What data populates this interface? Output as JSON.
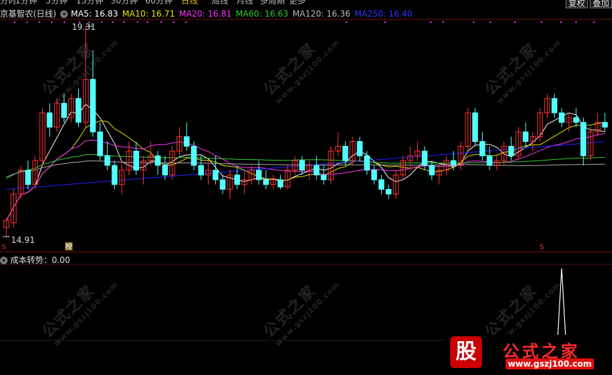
{
  "tabs": [
    "分时",
    "1分钟",
    "5分钟",
    "15分钟",
    "30分钟",
    "60分钟",
    "日线",
    "周线",
    "月线",
    "多周期",
    "更多"
  ],
  "active_tab": "日线",
  "buttons": {
    "b1": "复权",
    "b2": "叠加"
  },
  "legend": {
    "stock": "京基智农(日线)",
    "ma5": "MA5: 16.83",
    "ma10": "MA10: 16.71",
    "ma20": "MA20: 16.81",
    "ma60": "MA60: 16.63",
    "ma120": "MA120: 16.36",
    "ma250": "MA250: 16.40"
  },
  "labels": {
    "high": "19.31",
    "low": "14.91",
    "rank_badge": "榜",
    "s_badge_left": "S",
    "s_badge_right": "S"
  },
  "indicator": {
    "name": "成本转势：0.00"
  },
  "logo": {
    "gu": "股",
    "brand": "公式之家",
    "url": "www.gszj100.com"
  },
  "watermark": {
    "cn": "公式之家",
    "url": "www.gszj100.com"
  },
  "colors": {
    "up": "#ff3232",
    "down": "#54ffff",
    "ma5": "#ffffff",
    "ma10": "#e6e600",
    "ma20": "#ff33ff",
    "ma60": "#33cc33",
    "ma120": "#aaaaaa",
    "ma250": "#2222ff"
  },
  "chart_data": {
    "type": "candlestick",
    "price_range": [
      14.91,
      19.31
    ],
    "ohlc": [
      [
        15.1,
        15.3,
        14.91,
        15.25
      ],
      [
        15.2,
        15.9,
        15.1,
        15.8
      ],
      [
        15.8,
        16.4,
        15.7,
        16.3
      ],
      [
        16.3,
        16.5,
        15.9,
        16.0
      ],
      [
        16.0,
        16.6,
        15.9,
        16.5
      ],
      [
        16.5,
        17.6,
        16.4,
        17.5
      ],
      [
        17.5,
        17.7,
        17.0,
        17.2
      ],
      [
        17.2,
        17.8,
        17.1,
        17.7
      ],
      [
        17.7,
        17.9,
        17.3,
        17.4
      ],
      [
        17.4,
        17.9,
        17.3,
        17.8
      ],
      [
        17.8,
        18.0,
        17.2,
        17.3
      ],
      [
        17.3,
        19.31,
        17.2,
        18.2
      ],
      [
        18.2,
        18.8,
        17.0,
        17.1
      ],
      [
        17.1,
        17.3,
        16.5,
        16.6
      ],
      [
        16.6,
        16.9,
        16.3,
        16.4
      ],
      [
        16.4,
        16.5,
        15.9,
        16.0
      ],
      [
        16.0,
        16.5,
        15.8,
        16.3
      ],
      [
        16.3,
        16.9,
        16.2,
        16.7
      ],
      [
        16.7,
        16.9,
        16.2,
        16.3
      ],
      [
        16.3,
        16.6,
        16.0,
        16.5
      ],
      [
        16.5,
        16.9,
        16.4,
        16.6
      ],
      [
        16.6,
        16.7,
        16.2,
        16.4
      ],
      [
        16.4,
        16.6,
        16.1,
        16.2
      ],
      [
        16.2,
        16.8,
        16.1,
        16.7
      ],
      [
        16.7,
        17.2,
        16.6,
        17.0
      ],
      [
        17.0,
        17.3,
        16.7,
        16.8
      ],
      [
        16.8,
        16.9,
        16.3,
        16.4
      ],
      [
        16.4,
        16.6,
        16.1,
        16.2
      ],
      [
        16.2,
        16.5,
        16.0,
        16.3
      ],
      [
        16.3,
        16.6,
        16.0,
        16.1
      ],
      [
        16.1,
        16.2,
        15.8,
        15.9
      ],
      [
        15.9,
        16.3,
        15.7,
        16.2
      ],
      [
        16.2,
        16.4,
        15.9,
        16.0
      ],
      [
        16.0,
        16.3,
        15.8,
        16.1
      ],
      [
        16.1,
        16.4,
        16.0,
        16.3
      ],
      [
        16.3,
        16.5,
        16.0,
        16.1
      ],
      [
        16.1,
        16.3,
        15.9,
        16.0
      ],
      [
        16.0,
        16.2,
        15.9,
        16.1
      ],
      [
        16.1,
        16.2,
        15.9,
        15.95
      ],
      [
        15.95,
        16.4,
        15.9,
        16.3
      ],
      [
        16.3,
        16.6,
        16.2,
        16.5
      ],
      [
        16.5,
        16.6,
        16.2,
        16.3
      ],
      [
        16.3,
        16.5,
        16.1,
        16.4
      ],
      [
        16.4,
        16.6,
        16.1,
        16.2
      ],
      [
        16.2,
        16.4,
        16.0,
        16.1
      ],
      [
        16.1,
        16.8,
        16.0,
        16.7
      ],
      [
        16.7,
        17.1,
        16.6,
        16.8
      ],
      [
        16.8,
        16.9,
        16.4,
        16.5
      ],
      [
        16.5,
        17.0,
        16.4,
        16.9
      ],
      [
        16.9,
        17.0,
        16.5,
        16.6
      ],
      [
        16.6,
        16.7,
        16.2,
        16.3
      ],
      [
        16.3,
        16.4,
        16.0,
        16.1
      ],
      [
        16.1,
        16.2,
        15.8,
        15.9
      ],
      [
        15.9,
        16.0,
        15.7,
        15.8
      ],
      [
        15.8,
        16.3,
        15.7,
        16.2
      ],
      [
        16.2,
        16.6,
        16.1,
        16.5
      ],
      [
        16.5,
        16.8,
        16.3,
        16.6
      ],
      [
        16.6,
        16.9,
        16.5,
        16.7
      ],
      [
        16.7,
        16.8,
        16.3,
        16.4
      ],
      [
        16.4,
        16.5,
        16.1,
        16.2
      ],
      [
        16.2,
        16.4,
        16.0,
        16.3
      ],
      [
        16.3,
        16.6,
        16.2,
        16.5
      ],
      [
        16.5,
        16.7,
        16.3,
        16.4
      ],
      [
        16.4,
        16.9,
        16.3,
        16.8
      ],
      [
        16.8,
        17.6,
        16.7,
        17.5
      ],
      [
        17.5,
        17.6,
        16.8,
        16.9
      ],
      [
        16.9,
        17.1,
        16.5,
        16.6
      ],
      [
        16.6,
        16.8,
        16.3,
        16.4
      ],
      [
        16.4,
        16.6,
        16.3,
        16.5
      ],
      [
        16.5,
        16.9,
        16.4,
        16.8
      ],
      [
        16.8,
        17.0,
        16.5,
        16.6
      ],
      [
        16.6,
        17.2,
        16.5,
        17.1
      ],
      [
        17.1,
        17.3,
        16.8,
        16.9
      ],
      [
        16.9,
        17.1,
        16.7,
        17.0
      ],
      [
        17.0,
        17.6,
        16.9,
        17.5
      ],
      [
        17.5,
        17.9,
        17.4,
        17.8
      ],
      [
        17.8,
        17.9,
        17.4,
        17.5
      ],
      [
        17.5,
        17.6,
        17.2,
        17.3
      ],
      [
        17.3,
        17.5,
        17.1,
        17.4
      ],
      [
        17.4,
        17.6,
        17.2,
        17.3
      ],
      [
        17.3,
        17.4,
        16.4,
        16.6
      ],
      [
        16.6,
        17.2,
        16.5,
        17.1
      ],
      [
        17.1,
        17.5,
        17.0,
        17.3
      ],
      [
        17.3,
        17.5,
        17.1,
        17.2
      ]
    ],
    "indicator_spike": {
      "bar_index": 77,
      "value": 1
    }
  }
}
